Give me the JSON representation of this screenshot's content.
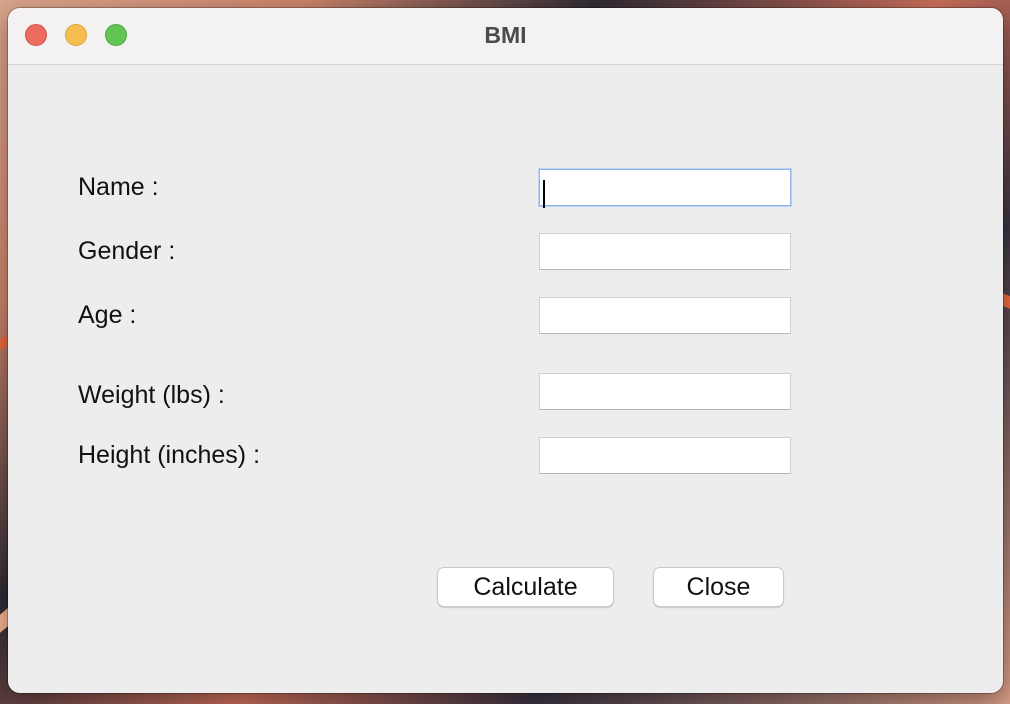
{
  "window": {
    "title": "BMI"
  },
  "form": {
    "fields": [
      {
        "label": "Name :",
        "value": "",
        "placeholder": ""
      },
      {
        "label": "Gender :",
        "value": "",
        "placeholder": ""
      },
      {
        "label": "Age :",
        "value": "",
        "placeholder": ""
      },
      {
        "label": "Weight (lbs) :",
        "value": "",
        "placeholder": ""
      },
      {
        "label": "Height (inches) :",
        "value": "",
        "placeholder": ""
      }
    ],
    "focused_field": "Name :"
  },
  "buttons": {
    "calculate_label": "Calculate",
    "close_label": "Close"
  },
  "colors": {
    "close_light": "#ec6a5e",
    "minimize_light": "#f4bf4f",
    "maximize_light": "#61c554",
    "focus_ring": "#8fb5e8",
    "window_background": "#eeeded"
  },
  "icons": {
    "close": "close-traffic-light-icon",
    "minimize": "minimize-traffic-light-icon",
    "maximize": "maximize-traffic-light-icon"
  }
}
